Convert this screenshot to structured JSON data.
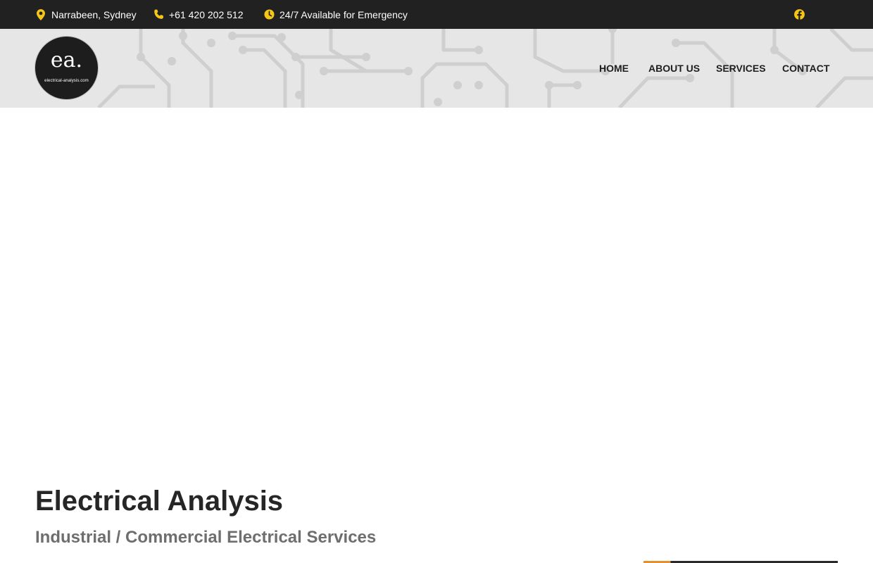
{
  "topbar": {
    "location": "Narrabeen, Sydney",
    "phone": "+61 420 202 512",
    "hours": "24/7 Available for Emergency",
    "icons": [
      "map-pin-icon",
      "phone-icon",
      "clock-icon",
      "facebook-icon"
    ]
  },
  "logo": {
    "mark": "ea.",
    "url": "electrical-analysis.com"
  },
  "nav": {
    "items": [
      {
        "label": "HOME"
      },
      {
        "label": "ABOUT US"
      },
      {
        "label": "SERVICES"
      },
      {
        "label": "CONTACT"
      }
    ]
  },
  "hero": {
    "title": "Electrical Analysis",
    "subtitle": "Industrial / Commercial Electrical Services"
  },
  "colors": {
    "topbar_bg": "#212121",
    "icon_accent": "#f5c518",
    "nav_bg": "#e6e6e6",
    "title": "#262626",
    "subtitle": "#6e6e6e"
  }
}
